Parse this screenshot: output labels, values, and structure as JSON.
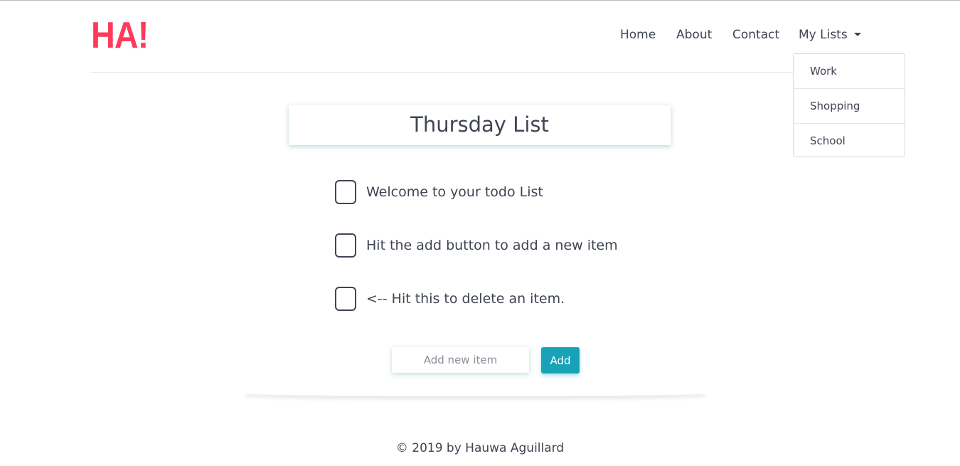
{
  "brand": {
    "logo_text": "HA!",
    "logo_color": "#ff3b5c"
  },
  "nav": {
    "home": "Home",
    "about": "About",
    "contact": "Contact",
    "my_lists": "My Lists",
    "dropdown_items": [
      "Work",
      "Shopping",
      "School"
    ]
  },
  "list": {
    "title": "Thursday List",
    "items": [
      "Welcome to your todo List",
      "Hit the add button to add a new item",
      "<-- Hit this to delete an item."
    ]
  },
  "add_form": {
    "placeholder": "Add new item",
    "button_label": "Add",
    "button_color": "#17a2b8"
  },
  "footer": {
    "copyright": "© 2019 by Hauwa Aguillard"
  }
}
